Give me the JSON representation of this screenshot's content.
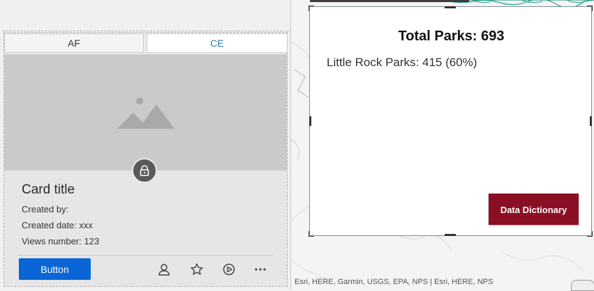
{
  "tabs": [
    {
      "label": "AF",
      "active": false
    },
    {
      "label": "CE",
      "active": true
    }
  ],
  "card": {
    "title": "Card title",
    "created_by": "Created by:",
    "created_date": "Created date: xxx",
    "views": "Views number: 123",
    "button_label": "Button",
    "icons": [
      "user-icon",
      "star-icon",
      "play-icon",
      "more-icon",
      "lock-icon",
      "image-placeholder-icon"
    ]
  },
  "stats": {
    "total": "Total Parks: 693",
    "little_rock": "Little Rock Parks: 415 (60%)",
    "button_label": "Data Dictionary"
  },
  "map": {
    "attribution": "Esri, HERE, Garmin, USGS, EPA, NPS | Esri, HERE, NPS"
  },
  "colors": {
    "tab_active_text": "#2a7fb8",
    "primary_button": "#0a66d6",
    "data_dictionary_button": "#8b0f24",
    "water": "#2a9d8f"
  }
}
